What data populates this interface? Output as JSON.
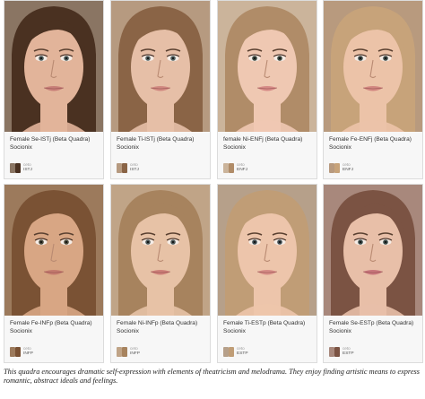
{
  "cards": [
    {
      "title": "Female Se-ISTj (Beta Quadra) Socionix",
      "user": "ceto",
      "tag": "ISTJ",
      "skin": "#e2b49a",
      "hair": "#4a3121",
      "bg": "#8a7563",
      "lips": "#c77e78",
      "eyes": "#4a5a5a"
    },
    {
      "title": "Female Ti-ISTj (Beta Quadra) Socionix",
      "user": "ceto",
      "tag": "ISTJ",
      "skin": "#e6bfa7",
      "hair": "#8a6446",
      "bg": "#b69a80",
      "lips": "#d08880",
      "eyes": "#4f5f60"
    },
    {
      "title": "female Ni-ENFj (Beta Quadra) Socionix",
      "user": "ceto",
      "tag": "ENFJ",
      "skin": "#efc8b2",
      "hair": "#b08c68",
      "bg": "#cbb49b",
      "lips": "#d68a86",
      "eyes": "#39473f"
    },
    {
      "title": "Female Fe-ENFj (Beta Quadra) Socionix",
      "user": "ceto",
      "tag": "ENFJ",
      "skin": "#ecc3a8",
      "hair": "#c7a37a",
      "bg": "#b89a7e",
      "lips": "#d28680",
      "eyes": "#3c4a48"
    },
    {
      "title": "Female Fe-INFp (Beta Quadra) Socionix",
      "user": "ceto",
      "tag": "INFP",
      "skin": "#d8a684",
      "hair": "#7a5234",
      "bg": "#9c7a5c",
      "lips": "#c47a6e",
      "eyes": "#4c4a3a"
    },
    {
      "title": "Female Ni-INFp (Beta Quadra) Socionix",
      "user": "ceto",
      "tag": "INFP",
      "skin": "#e7c2a6",
      "hair": "#a7835e",
      "bg": "#c0a487",
      "lips": "#cd7f78",
      "eyes": "#4a5656"
    },
    {
      "title": "Female Ti-ESTp (Beta Quadra) Socionix",
      "user": "ceto",
      "tag": "ESTP",
      "skin": "#edc5ab",
      "hair": "#c09d76",
      "bg": "#b6a08a",
      "lips": "#d58b85",
      "eyes": "#3e4b50"
    },
    {
      "title": "Female Se-ESTp (Beta Quadra) Socionix",
      "user": "ceto",
      "tag": "ESTP",
      "skin": "#e8bfa8",
      "hair": "#7b5343",
      "bg": "#a8887c",
      "lips": "#c8767c",
      "eyes": "#3a4a48"
    }
  ],
  "caption": "This quadra encourages dramatic self-expression with elements of theatricism and melodrama. They enjoy finding artistic means to express romantic, abstract ideals and feelings."
}
